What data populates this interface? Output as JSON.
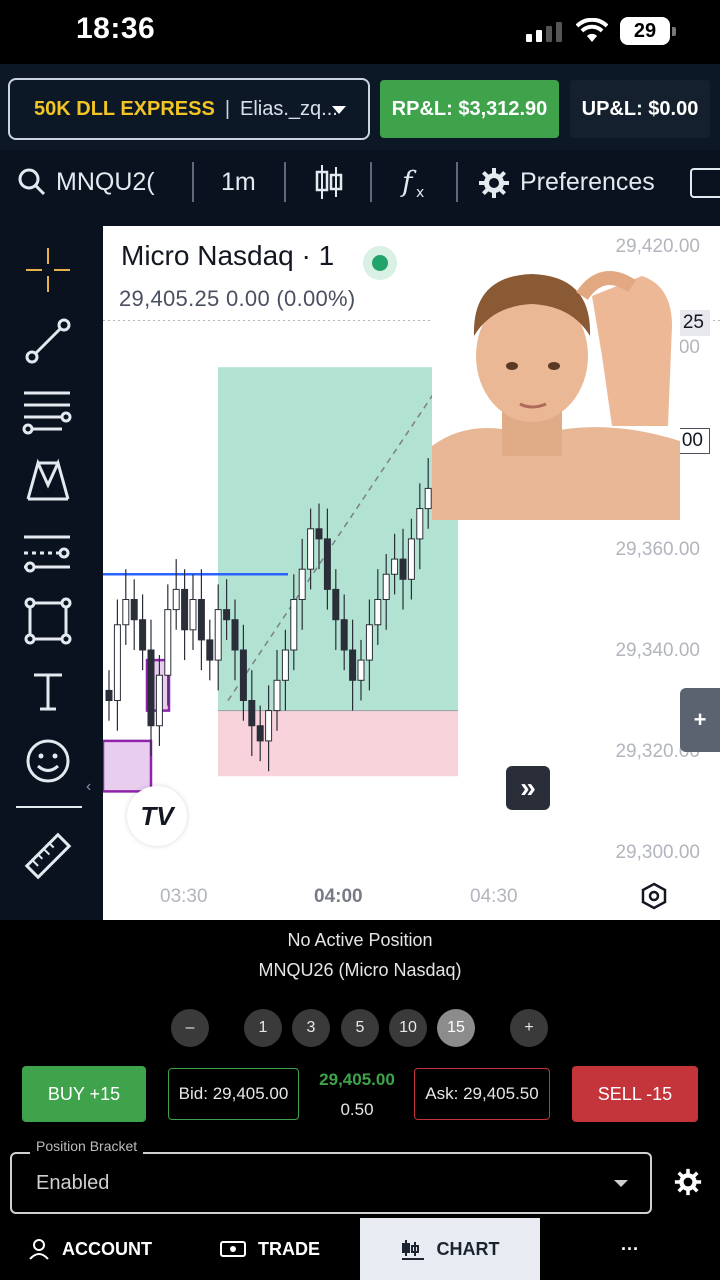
{
  "status": {
    "time": "18:36",
    "battery": "29"
  },
  "header": {
    "account_name": "50K DLL EXPRESS",
    "account_user": "Elias._zq...",
    "rpl": "RP&L: $3,312.90",
    "upl": "UP&L: $0.00"
  },
  "toolbar": {
    "symbol": "MNQU2(",
    "interval": "1m",
    "preferences": "Preferences"
  },
  "chart": {
    "instrument": "Micro Nasdaq · 1",
    "quote": "29,405.25  0.00 (0.00%)",
    "y_labels": [
      "29,420.00",
      "25",
      "00",
      "00",
      "29,360.00",
      "29,340.00",
      "29,320.00",
      "29,300.00"
    ],
    "x_labels": [
      "03:30",
      "04:00",
      "04:30"
    ],
    "logo": "TV"
  },
  "chart_data": {
    "type": "candlestick",
    "instrument": "Micro Nasdaq · 1",
    "last": 29405.25,
    "change": 0.0,
    "change_pct": 0.0,
    "ylim": [
      29300,
      29420
    ],
    "x_ticks": [
      "03:30",
      "04:00",
      "04:30"
    ],
    "close_series": [
      29330,
      29345,
      29350,
      29346,
      29340,
      29325,
      29335,
      29348,
      29352,
      29344,
      29350,
      29342,
      29338,
      29348,
      29346,
      29340,
      29330,
      29325,
      29322,
      29328,
      29334,
      29340,
      29350,
      29356,
      29364,
      29362,
      29352,
      29346,
      29340,
      29334,
      29338,
      29345,
      29350,
      29355,
      29358,
      29354,
      29362,
      29368,
      29372,
      29376,
      29380,
      29385,
      29392,
      29398,
      29402,
      29405.25
    ],
    "long_position": {
      "entry": 29328,
      "target": 29396,
      "stop": 29315
    }
  },
  "trade": {
    "no_position": "No Active Position",
    "instrument": "MNQU26 (Micro Nasdaq)",
    "qty_minus": "–",
    "qty_options": [
      "1",
      "3",
      "5",
      "10",
      "15"
    ],
    "qty_selected": "15",
    "qty_plus": "+",
    "buy": "BUY +15",
    "sell": "SELL -15",
    "bid": "Bid: 29,405.00",
    "ask": "Ask: 29,405.50",
    "last": "29,405.00",
    "spread": "0.50",
    "bracket_label": "Position Bracket",
    "bracket_value": "Enabled"
  },
  "nav": {
    "account": "ACCOUNT",
    "trade": "TRADE",
    "chart": "CHART",
    "more": "···"
  },
  "colors": {
    "buy": "#3ea34a",
    "sell": "#c4343b",
    "accent": "#f2c424",
    "header_bg": "#0d1826"
  }
}
